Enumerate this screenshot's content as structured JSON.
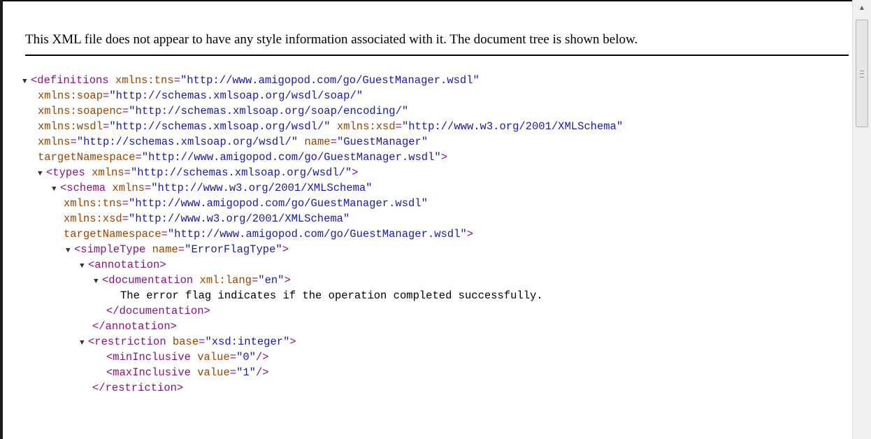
{
  "info_bar": {
    "text": "This XML file does not appear to have any style information associated with it. The document tree is shown below."
  },
  "tree": {
    "toggle_glyph": "▼",
    "definitions": {
      "open": "<definitions ",
      "attrs": [
        {
          "name": "xmlns:tns",
          "value": "\"http://www.amigopod.com/go/GuestManager.wsdl\""
        },
        {
          "name": "xmlns:soap",
          "value": "\"http://schemas.xmlsoap.org/wsdl/soap/\""
        },
        {
          "name": "xmlns:soapenc",
          "value": "\"http://schemas.xmlsoap.org/soap/encoding/\""
        },
        {
          "name": "xmlns:wsdl",
          "value": "\"http://schemas.xmlsoap.org/wsdl/\""
        },
        {
          "name": "xmlns:xsd",
          "value": "\"http://www.w3.org/2001/XMLSchema\""
        },
        {
          "name": "xmlns",
          "value": "\"http://schemas.xmlsoap.org/wsdl/\""
        },
        {
          "name": "name",
          "value": "\"GuestManager\""
        },
        {
          "name": "targetNamespace",
          "value": "\"http://www.amigopod.com/go/GuestManager.wsdl\""
        }
      ]
    },
    "types": {
      "open": "<types ",
      "attrs": [
        {
          "name": "xmlns",
          "value": "\"http://schemas.xmlsoap.org/wsdl/\""
        }
      ]
    },
    "schema": {
      "open": "<schema ",
      "attrs": [
        {
          "name": "xmlns",
          "value": "\"http://www.w3.org/2001/XMLSchema\""
        },
        {
          "name": "xmlns:tns",
          "value": "\"http://www.amigopod.com/go/GuestManager.wsdl\""
        },
        {
          "name": "xmlns:xsd",
          "value": "\"http://www.w3.org/2001/XMLSchema\""
        },
        {
          "name": "targetNamespace",
          "value": "\"http://www.amigopod.com/go/GuestManager.wsdl\""
        }
      ]
    },
    "simpleType": {
      "open": "<simpleType ",
      "attrs": [
        {
          "name": "name",
          "value": "\"ErrorFlagType\""
        }
      ]
    },
    "annotation_open": "<annotation>",
    "documentation": {
      "open": "<documentation ",
      "attrs": [
        {
          "name": "xml:lang",
          "value": "\"en\""
        }
      ]
    },
    "documentation_text": "The error flag indicates if the operation completed successfully.",
    "documentation_close": "</documentation>",
    "annotation_close": "</annotation>",
    "restriction": {
      "open": "<restriction ",
      "attrs": [
        {
          "name": "base",
          "value": "\"xsd:integer\""
        }
      ]
    },
    "minInclusive": {
      "open": "<minInclusive ",
      "attrs": [
        {
          "name": "value",
          "value": "\"0\""
        }
      ],
      "close": "/>"
    },
    "maxInclusive": {
      "open": "<maxInclusive ",
      "attrs": [
        {
          "name": "value",
          "value": "\"1\""
        }
      ],
      "close": "/>"
    },
    "restriction_close": "</restriction>",
    "tag_end": ">",
    "equals": "="
  }
}
